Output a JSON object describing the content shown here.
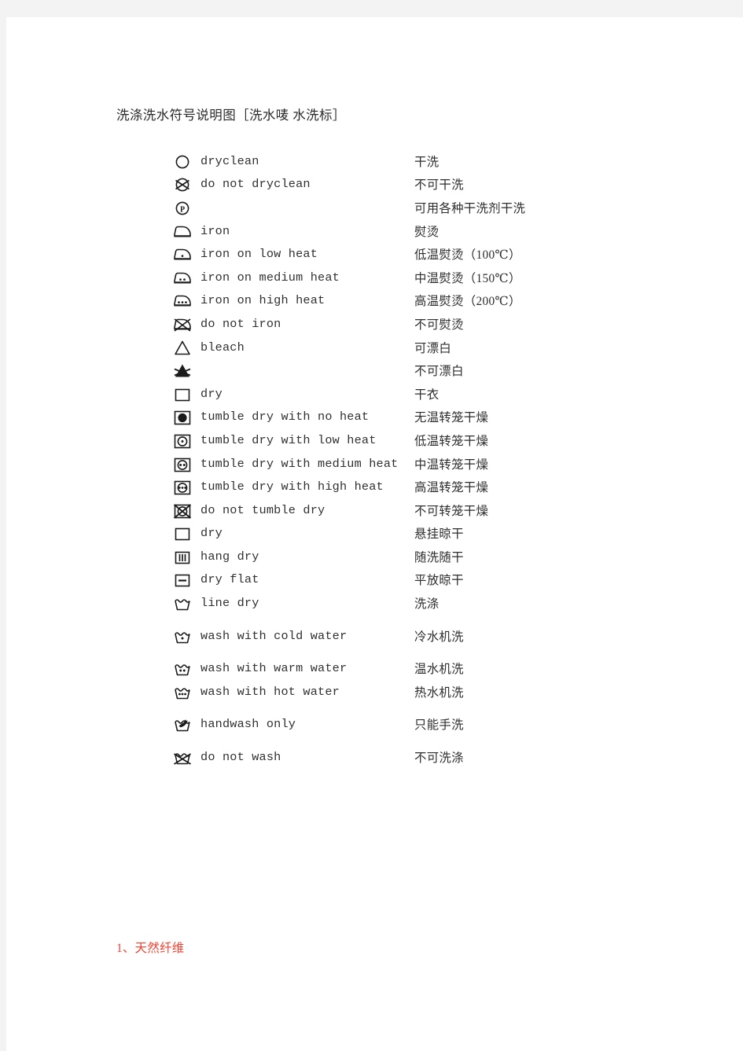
{
  "document": {
    "title": "洗涤洗水符号说明图［洗水唛 水洗标］",
    "footnote": "1、天然纤维",
    "footnote_color": "#f4402f",
    "page_background": "#ffffff",
    "canvas_background": "#f3f3f4",
    "text_color": "#2d2d2d"
  },
  "symbols": [
    {
      "icon": "circle-dryclean-icon",
      "en": "dryclean",
      "zh": "干洗",
      "gap_before": 0
    },
    {
      "icon": "circle-crossed-no-dryclean-icon",
      "en": "do not dryclean",
      "zh": "不可干洗",
      "gap_before": 0
    },
    {
      "icon": "circle-p-dryclean-solvent-icon",
      "en": "",
      "zh": "可用各种干洗剂干洗",
      "gap_before": 0
    },
    {
      "icon": "iron-icon",
      "en": "iron",
      "zh": "熨烫",
      "gap_before": 0
    },
    {
      "icon": "iron-one-dot-icon",
      "en": "iron on low heat",
      "zh": "低温熨烫（100℃）",
      "gap_before": 0
    },
    {
      "icon": "iron-two-dots-icon",
      "en": "iron on medium heat",
      "zh": "中温熨烫（150℃）",
      "gap_before": 0
    },
    {
      "icon": "iron-three-dots-icon",
      "en": "iron on high heat",
      "zh": "高温熨烫（200℃）",
      "gap_before": 0
    },
    {
      "icon": "iron-crossed-no-iron-icon",
      "en": "do not iron",
      "zh": "不可熨烫",
      "gap_before": 0
    },
    {
      "icon": "triangle-bleach-icon",
      "en": "bleach",
      "zh": "可漂白",
      "gap_before": 0
    },
    {
      "icon": "triangle-filled-no-bleach-icon",
      "en": "",
      "zh": "不可漂白",
      "gap_before": 0
    },
    {
      "icon": "square-dry-icon",
      "en": "dry",
      "zh": "干衣",
      "gap_before": 0
    },
    {
      "icon": "tumble-dry-no-heat-icon",
      "en": "tumble dry with no heat",
      "zh": "无温转笼干燥",
      "gap_before": 0
    },
    {
      "icon": "tumble-dry-low-heat-icon",
      "en": "tumble dry with low heat",
      "zh": "低温转笼干燥",
      "gap_before": 0
    },
    {
      "icon": "tumble-dry-medium-heat-icon",
      "en": "tumble dry with medium heat",
      "zh": "中温转笼干燥",
      "gap_before": 0
    },
    {
      "icon": "tumble-dry-high-heat-icon",
      "en": "tumble dry with high heat",
      "zh": "高温转笼干燥",
      "gap_before": 0
    },
    {
      "icon": "tumble-dry-crossed-icon",
      "en": "do not tumble dry",
      "zh": "不可转笼干燥",
      "gap_before": 0
    },
    {
      "icon": "square-dry-icon",
      "en": "dry",
      "zh": "悬挂晾干",
      "gap_before": 0
    },
    {
      "icon": "square-bars-hang-dry-icon",
      "en": "hang dry",
      "zh": "随洗随干",
      "gap_before": 0
    },
    {
      "icon": "square-line-dry-flat-icon",
      "en": "dry flat",
      "zh": "平放晾干",
      "gap_before": 0
    },
    {
      "icon": "washtub-line-dry-icon",
      "en": "line dry",
      "zh": "洗涤",
      "gap_before": 0
    },
    {
      "icon": "washtub-one-dot-cold-icon",
      "en": "wash with cold water",
      "zh": "冷水机洗",
      "gap_before": 12
    },
    {
      "icon": "washtub-two-dots-warm-icon",
      "en": "wash with warm water",
      "zh": "温水机洗",
      "gap_before": 12
    },
    {
      "icon": "washtub-three-dots-hot-icon",
      "en": "wash with hot water",
      "zh": "热水机洗",
      "gap_before": 0
    },
    {
      "icon": "washtub-hand-handwash-icon",
      "en": "handwash only",
      "zh": "只能手洗",
      "gap_before": 12
    },
    {
      "icon": "washtub-crossed-no-wash-icon",
      "en": "do not wash",
      "zh": "不可洗涤",
      "gap_before": 12
    }
  ]
}
